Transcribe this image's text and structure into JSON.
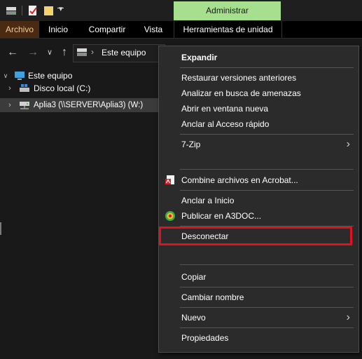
{
  "ribbon": {
    "context_group_label": "Administrar",
    "tabs": [
      "Archivo",
      "Inicio",
      "Compartir",
      "Vista",
      "Herramientas de unidad"
    ]
  },
  "address": {
    "current": "Este equipo"
  },
  "tree": {
    "root": "Este equipo",
    "items": [
      "Disco local (C:)",
      "Aplia3 (\\\\SERVER\\Aplia3) (W:)"
    ]
  },
  "menu": {
    "expandir": "Expandir",
    "restaurar": "Restaurar versiones anteriores",
    "analizar": "Analizar en busca de amenazas",
    "abrir_ventana": "Abrir en ventana nueva",
    "anclar_acceso": "Anclar al Acceso rápido",
    "sevenzip": "7-Zip",
    "combine": "Combine archivos en Acrobat...",
    "anclar_inicio": "Anclar a Inicio",
    "publicar": "Publicar en A3DOC...",
    "desconectar": "Desconectar",
    "copiar": "Copiar",
    "cambiar_nombre": "Cambiar nombre",
    "nuevo": "Nuevo",
    "propiedades": "Propiedades"
  },
  "colors": {
    "highlight": "#e0121e",
    "context_tab": "#a6e08f",
    "archivo_tab": "#4a2b12"
  }
}
